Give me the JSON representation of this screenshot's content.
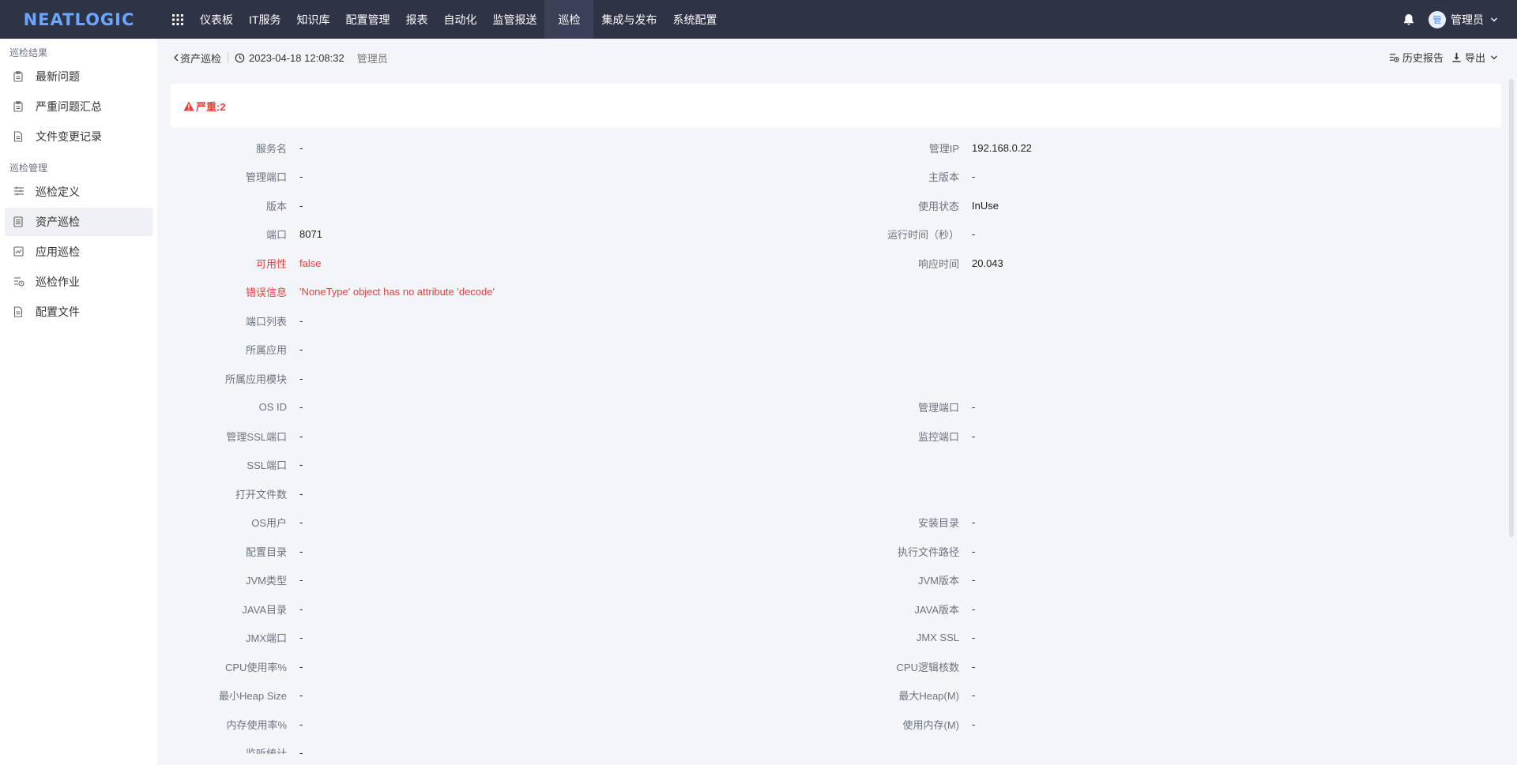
{
  "app": {
    "logo": "NEATLOGIC",
    "nav": [
      "仪表板",
      "IT服务",
      "知识库",
      "配置管理",
      "报表",
      "自动化",
      "监管报送",
      "巡检",
      "集成与发布",
      "系统配置"
    ],
    "active_nav": "巡检",
    "user": {
      "avatar_text": "管",
      "name": "管理员"
    }
  },
  "sidebar": {
    "groups": [
      {
        "title": "巡检结果",
        "items": [
          {
            "label": "最新问题",
            "icon": "clipboard-icon"
          },
          {
            "label": "严重问题汇总",
            "icon": "clipboard-icon"
          },
          {
            "label": "文件变更记录",
            "icon": "document-icon"
          }
        ]
      },
      {
        "title": "巡检管理",
        "items": [
          {
            "label": "巡检定义",
            "icon": "sliders-icon"
          },
          {
            "label": "资产巡检",
            "icon": "list-icon",
            "active": true
          },
          {
            "label": "应用巡检",
            "icon": "chart-icon"
          },
          {
            "label": "巡检作业",
            "icon": "job-icon"
          },
          {
            "label": "配置文件",
            "icon": "document-icon"
          }
        ]
      }
    ]
  },
  "breadcrumb": {
    "back_label": "资产巡检",
    "time": "2023-04-18 12:08:32",
    "user": "管理员"
  },
  "actions": {
    "history": "历史报告",
    "export": "导出"
  },
  "alert": {
    "label": "严重:2",
    "color": "#e83f3f"
  },
  "fields": [
    {
      "left": {
        "label": "服务名",
        "value": "-"
      },
      "right": {
        "label": "管理IP",
        "value": "192.168.0.22"
      }
    },
    {
      "left": {
        "label": "管理端口",
        "value": "-"
      },
      "right": {
        "label": "主版本",
        "value": "-"
      }
    },
    {
      "left": {
        "label": "版本",
        "value": "-"
      },
      "right": {
        "label": "使用状态",
        "value": "InUse"
      }
    },
    {
      "left": {
        "label": "端口",
        "value": "8071"
      },
      "right": {
        "label": "运行时间（秒）",
        "value": "-"
      }
    },
    {
      "left": {
        "label": "可用性",
        "value": "false",
        "danger": true
      },
      "right": {
        "label": "响应时间",
        "value": "20.043"
      }
    },
    {
      "left": {
        "label": "错误信息",
        "value": "'NoneType' object has no attribute 'decode'",
        "danger": true
      }
    },
    {
      "left": {
        "label": "端口列表",
        "value": "-"
      }
    },
    {
      "left": {
        "label": "所属应用",
        "value": "-"
      }
    },
    {
      "left": {
        "label": "所属应用模块",
        "value": "-"
      }
    },
    {
      "left": {
        "label": "OS ID",
        "value": "-"
      },
      "right": {
        "label": "管理端口",
        "value": "-"
      }
    },
    {
      "left": {
        "label": "管理SSL端口",
        "value": "-"
      },
      "right": {
        "label": "监控端口",
        "value": "-"
      }
    },
    {
      "left": {
        "label": "SSL端口",
        "value": "-"
      }
    },
    {
      "left": {
        "label": "打开文件数",
        "value": "-"
      }
    },
    {
      "left": {
        "label": "OS用户",
        "value": "-"
      },
      "right": {
        "label": "安装目录",
        "value": "-"
      }
    },
    {
      "left": {
        "label": "配置目录",
        "value": "-"
      },
      "right": {
        "label": "执行文件路径",
        "value": "-"
      }
    },
    {
      "left": {
        "label": "JVM类型",
        "value": "-"
      },
      "right": {
        "label": "JVM版本",
        "value": "-"
      }
    },
    {
      "left": {
        "label": "JAVA目录",
        "value": "-"
      },
      "right": {
        "label": "JAVA版本",
        "value": "-"
      }
    },
    {
      "left": {
        "label": "JMX端口",
        "value": "-"
      },
      "right": {
        "label": "JMX SSL",
        "value": "-"
      }
    },
    {
      "left": {
        "label": "CPU使用率%",
        "value": "-"
      },
      "right": {
        "label": "CPU逻辑核数",
        "value": "-"
      }
    },
    {
      "left": {
        "label": "最小Heap Size",
        "value": "-"
      },
      "right": {
        "label": "最大Heap(M)",
        "value": "-"
      }
    },
    {
      "left": {
        "label": "内存使用率%",
        "value": "-"
      },
      "right": {
        "label": "使用内存(M)",
        "value": "-"
      }
    },
    {
      "left": {
        "label": "监听统计",
        "value": "-"
      }
    }
  ]
}
